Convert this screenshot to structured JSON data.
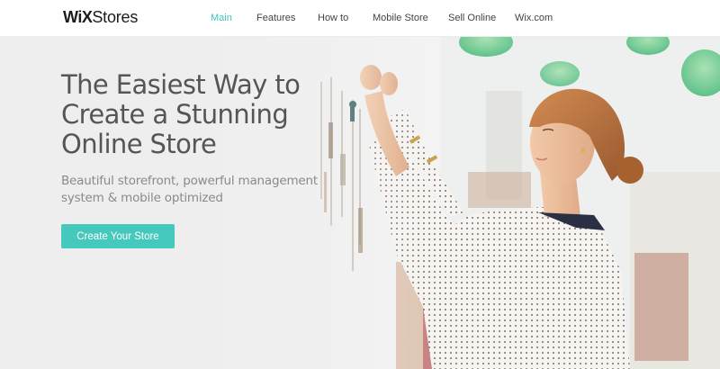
{
  "header": {
    "logo": {
      "wix": "WiX",
      "stores": "Stores"
    },
    "nav": [
      {
        "label": "Main",
        "active": true
      },
      {
        "label": "Features",
        "active": false
      },
      {
        "label": "How to",
        "active": false
      },
      {
        "label": "Mobile Store",
        "active": false
      },
      {
        "label": "Sell Online",
        "active": false
      },
      {
        "label": "Wix.com",
        "active": false
      }
    ]
  },
  "hero": {
    "headline": [
      "The Easiest Way to",
      "Create a Stunning",
      "Online Store"
    ],
    "subheadline": [
      "Beautiful storefront, powerful management",
      "system & mobile optimized"
    ],
    "cta_label": "Create Your Store",
    "image_description": "woman-hanging-jewelry-photo"
  },
  "colors": {
    "accent": "#46c9bd",
    "nav_active": "#3bc4b8",
    "headline": "#555555",
    "subheadline": "#8a8a8a"
  }
}
